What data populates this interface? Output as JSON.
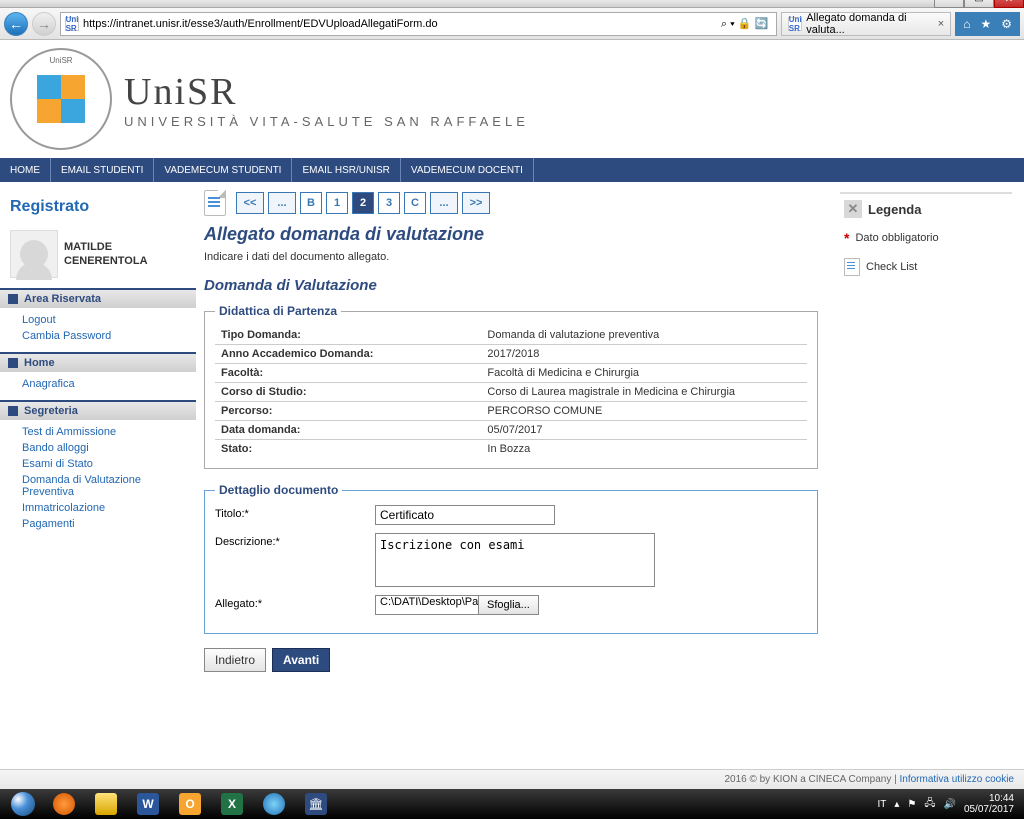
{
  "browser": {
    "url": "https://intranet.unisr.it/esse3/auth/Enrollment/EDVUploadAllegatiForm.do",
    "tab_title": "Allegato domanda di valuta...",
    "searchIcons": "⌕  ▾  🔒  🔄"
  },
  "brand": {
    "title": "UniSR",
    "subtitle": "UNIVERSITÀ VITA-SALUTE SAN RAFFAELE",
    "ring": "UniSR"
  },
  "topnav": [
    "HOME",
    "EMAIL STUDENTI",
    "VADEMECUM STUDENTI",
    "EMAIL HSR/UNISR",
    "VADEMECUM DOCENTI"
  ],
  "sidebar": {
    "registered_label": "Registrato",
    "user_first": "MATILDE",
    "user_last": "CENERENTOLA",
    "sections": [
      {
        "title": "Area Riservata",
        "links": [
          "Logout",
          "Cambia Password"
        ]
      },
      {
        "title": "Home",
        "links": [
          "Anagrafica"
        ]
      },
      {
        "title": "Segreteria",
        "links": [
          "Test di Ammissione",
          "Bando alloggi",
          "Esami di Stato",
          "Domanda di Valutazione Preventiva",
          "Immatricolazione",
          "Pagamenti"
        ]
      }
    ]
  },
  "stepper": {
    "before": "<<",
    "dots1": "...",
    "B": "B",
    "one": "1",
    "two": "2",
    "three": "3",
    "C": "C",
    "dots2": "...",
    "after": ">>"
  },
  "page": {
    "title": "Allegato domanda di valutazione",
    "instruction": "Indicare i dati del documento allegato.",
    "section_title": "Domanda di Valutazione"
  },
  "didattica": {
    "legend": "Didattica di Partenza",
    "rows": [
      {
        "label": "Tipo Domanda:",
        "value": "Domanda di valutazione preventiva"
      },
      {
        "label": "Anno Accademico Domanda:",
        "value": "2017/2018"
      },
      {
        "label": "Facoltà:",
        "value": "Facoltà di Medicina e Chirurgia"
      },
      {
        "label": "Corso di Studio:",
        "value": "Corso di Laurea magistrale in Medicina e Chirurgia"
      },
      {
        "label": "Percorso:",
        "value": "PERCORSO COMUNE"
      },
      {
        "label": "Data domanda:",
        "value": "05/07/2017"
      },
      {
        "label": "Stato:",
        "value": "In Bozza"
      }
    ]
  },
  "dettaglio": {
    "legend": "Dettaglio documento",
    "titolo_label": "Titolo:*",
    "titolo_value": "Certificato",
    "descr_label": "Descrizione:*",
    "descr_value": "Iscrizione con esami",
    "allegato_label": "Allegato:*",
    "allegato_path": "C:\\DATI\\Desktop\\Paola T",
    "sfoglia": "Sfoglia..."
  },
  "buttons": {
    "back": "Indietro",
    "next": "Avanti"
  },
  "legend": {
    "title": "Legenda",
    "mandatory": "Dato obbligatorio",
    "checklist": "Check List"
  },
  "footer": {
    "copyright": "2016 © by KION a CINECA Company",
    "sep": " | ",
    "link": "Informativa utilizzo cookie"
  },
  "tray": {
    "lang": "IT",
    "time": "10:44",
    "date": "05/07/2017"
  }
}
